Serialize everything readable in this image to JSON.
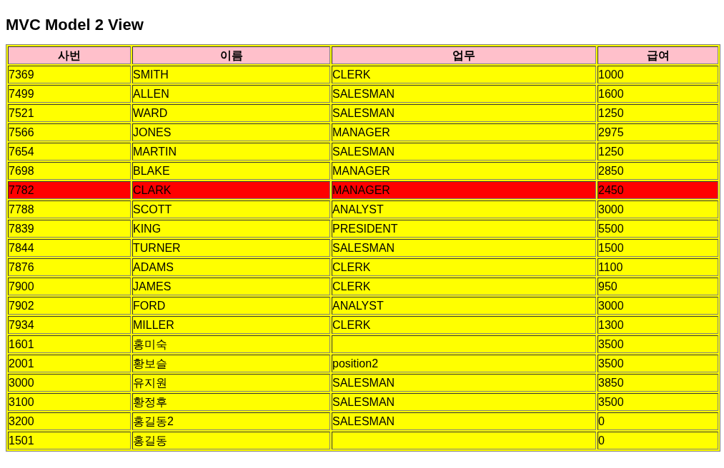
{
  "title": "MVC Model 2 View",
  "table": {
    "columns": [
      "사번",
      "이름",
      "업무",
      "급여"
    ],
    "rows": [
      {
        "cells": [
          "7369",
          "SMITH",
          "CLERK",
          "1000"
        ],
        "highlighted": false
      },
      {
        "cells": [
          "7499",
          "ALLEN",
          "SALESMAN",
          "1600"
        ],
        "highlighted": false
      },
      {
        "cells": [
          "7521",
          "WARD",
          "SALESMAN",
          "1250"
        ],
        "highlighted": false
      },
      {
        "cells": [
          "7566",
          "JONES",
          "MANAGER",
          "2975"
        ],
        "highlighted": false
      },
      {
        "cells": [
          "7654",
          "MARTIN",
          "SALESMAN",
          "1250"
        ],
        "highlighted": false
      },
      {
        "cells": [
          "7698",
          "BLAKE",
          "MANAGER",
          "2850"
        ],
        "highlighted": false
      },
      {
        "cells": [
          "7782",
          "CLARK",
          "MANAGER",
          "2450"
        ],
        "highlighted": true
      },
      {
        "cells": [
          "7788",
          "SCOTT",
          "ANALYST",
          "3000"
        ],
        "highlighted": false
      },
      {
        "cells": [
          "7839",
          "KING",
          "PRESIDENT",
          "5500"
        ],
        "highlighted": false
      },
      {
        "cells": [
          "7844",
          "TURNER",
          "SALESMAN",
          "1500"
        ],
        "highlighted": false
      },
      {
        "cells": [
          "7876",
          "ADAMS",
          "CLERK",
          "1100"
        ],
        "highlighted": false
      },
      {
        "cells": [
          "7900",
          "JAMES",
          "CLERK",
          "950"
        ],
        "highlighted": false
      },
      {
        "cells": [
          "7902",
          "FORD",
          "ANALYST",
          "3000"
        ],
        "highlighted": false
      },
      {
        "cells": [
          "7934",
          "MILLER",
          "CLERK",
          "1300"
        ],
        "highlighted": false
      },
      {
        "cells": [
          "1601",
          "홍미숙",
          null,
          "3500"
        ],
        "highlighted": false
      },
      {
        "cells": [
          "2001",
          "황보슬",
          "position2",
          "3500"
        ],
        "highlighted": false
      },
      {
        "cells": [
          "3000",
          "유지원",
          "SALESMAN",
          "3850"
        ],
        "highlighted": false
      },
      {
        "cells": [
          "3100",
          "황정후",
          "SALESMAN",
          "3500"
        ],
        "highlighted": false
      },
      {
        "cells": [
          "3200",
          "홍길동2",
          "SALESMAN",
          "0"
        ],
        "highlighted": false
      },
      {
        "cells": [
          "1501",
          "홍길동",
          null,
          "0"
        ],
        "highlighted": false
      }
    ]
  }
}
